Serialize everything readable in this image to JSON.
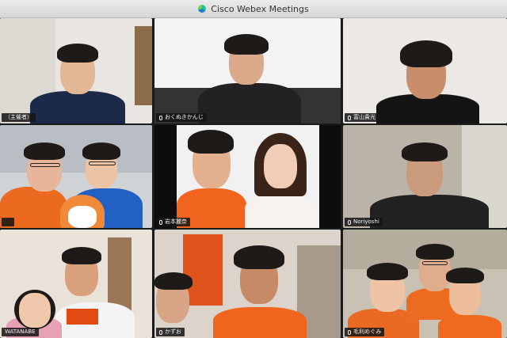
{
  "window": {
    "title": "Cisco Webex Meetings"
  },
  "participants": [
    {
      "name": "（主催者）",
      "show_mic": false
    },
    {
      "name": "おくぬきかんじ",
      "show_mic": true
    },
    {
      "name": "富山貴光",
      "show_mic": true
    },
    {
      "name": "",
      "show_mic": false
    },
    {
      "name": "岩本麗奈",
      "show_mic": true
    },
    {
      "name": "Noriyoshi",
      "show_mic": true
    },
    {
      "name": "WATANABE",
      "show_mic": false
    },
    {
      "name": "かずお",
      "show_mic": true
    },
    {
      "name": "毛利めぐみ",
      "show_mic": true
    }
  ],
  "colors": {
    "accent_orange": "#f0641e",
    "background": "#1b1b1b"
  }
}
